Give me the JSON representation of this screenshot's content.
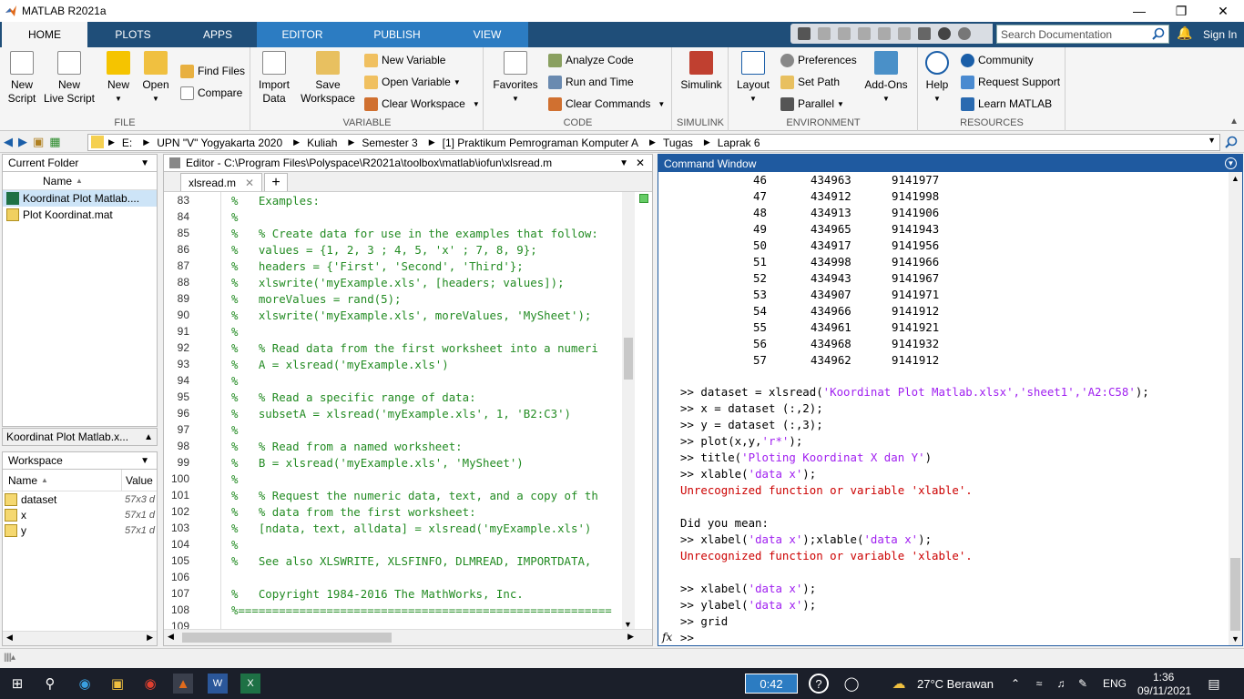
{
  "window": {
    "title": "MATLAB R2021a"
  },
  "tabs": [
    {
      "label": "HOME"
    },
    {
      "label": "PLOTS"
    },
    {
      "label": "APPS"
    },
    {
      "label": "EDITOR"
    },
    {
      "label": "PUBLISH"
    },
    {
      "label": "VIEW"
    }
  ],
  "search_doc": {
    "placeholder": "Search Documentation"
  },
  "sign_in": "Sign In",
  "ribbon": {
    "file": {
      "label": "FILE",
      "new_script": "New\nScript",
      "new_live_script": "New\nLive Script",
      "new": "New",
      "open": "Open",
      "find_files": "Find Files",
      "compare": "Compare"
    },
    "variable": {
      "label": "VARIABLE",
      "import_data": "Import\nData",
      "save_workspace": "Save\nWorkspace",
      "new_variable": "New Variable",
      "open_variable": "Open Variable",
      "clear_workspace": "Clear Workspace"
    },
    "code": {
      "label": "CODE",
      "favorites": "Favorites",
      "analyze_code": "Analyze Code",
      "run_and_time": "Run and Time",
      "clear_commands": "Clear Commands"
    },
    "simulink": {
      "label": "SIMULINK",
      "simulink": "Simulink"
    },
    "environment": {
      "label": "ENVIRONMENT",
      "layout": "Layout",
      "preferences": "Preferences",
      "set_path": "Set Path",
      "parallel": "Parallel",
      "add_ons": "Add-Ons"
    },
    "resources": {
      "label": "RESOURCES",
      "help": "Help",
      "community": "Community",
      "request_support": "Request Support",
      "learn_matlab": "Learn MATLAB"
    }
  },
  "address": {
    "crumbs": [
      "E:",
      "UPN \"V\" Yogyakarta 2020",
      "Kuliah",
      "Semester 3",
      "[1] Praktikum Pemrograman Komputer A",
      "Tugas",
      "Laprak 6"
    ]
  },
  "current_folder": {
    "title": "Current Folder",
    "column": "Name",
    "files": [
      {
        "name": "Koordinat Plot Matlab...."
      },
      {
        "name": "Plot Koordinat.mat"
      }
    ],
    "detail": "Koordinat Plot Matlab.x..."
  },
  "workspace": {
    "title": "Workspace",
    "col_name": "Name",
    "col_value": "Value",
    "vars": [
      {
        "name": "dataset",
        "value": "57x3 d"
      },
      {
        "name": "x",
        "value": "57x1 d"
      },
      {
        "name": "y",
        "value": "57x1 d"
      }
    ]
  },
  "editor": {
    "title": "Editor - C:\\Program Files\\Polyspace\\R2021a\\toolbox\\matlab\\iofun\\xlsread.m",
    "tab": "xlsread.m",
    "lines": [
      {
        "n": "83",
        "t": "%   Examples:"
      },
      {
        "n": "84",
        "t": "%"
      },
      {
        "n": "85",
        "t": "%   % Create data for use in the examples that follow:"
      },
      {
        "n": "86",
        "t": "%   values = {1, 2, 3 ; 4, 5, 'x' ; 7, 8, 9};"
      },
      {
        "n": "87",
        "t": "%   headers = {'First', 'Second', 'Third'};"
      },
      {
        "n": "88",
        "t": "%   xlswrite('myExample.xls', [headers; values]);"
      },
      {
        "n": "89",
        "t": "%   moreValues = rand(5);"
      },
      {
        "n": "90",
        "t": "%   xlswrite('myExample.xls', moreValues, 'MySheet');"
      },
      {
        "n": "91",
        "t": "%"
      },
      {
        "n": "92",
        "t": "%   % Read data from the first worksheet into a numeri"
      },
      {
        "n": "93",
        "t": "%   A = xlsread('myExample.xls')"
      },
      {
        "n": "94",
        "t": "%"
      },
      {
        "n": "95",
        "t": "%   % Read a specific range of data:"
      },
      {
        "n": "96",
        "t": "%   subsetA = xlsread('myExample.xls', 1, 'B2:C3')"
      },
      {
        "n": "97",
        "t": "%"
      },
      {
        "n": "98",
        "t": "%   % Read from a named worksheet:"
      },
      {
        "n": "99",
        "t": "%   B = xlsread('myExample.xls', 'MySheet')"
      },
      {
        "n": "100",
        "t": "%"
      },
      {
        "n": "101",
        "t": "%   % Request the numeric data, text, and a copy of th"
      },
      {
        "n": "102",
        "t": "%   % data from the first worksheet:"
      },
      {
        "n": "103",
        "t": "%   [ndata, text, alldata] = xlsread('myExample.xls')"
      },
      {
        "n": "104",
        "t": "%"
      },
      {
        "n": "105",
        "t": "%   See also XLSWRITE, XLSFINFO, DLMREAD, IMPORTDATA,"
      },
      {
        "n": "106",
        "t": ""
      },
      {
        "n": "107",
        "t": "%   Copyright 1984-2016 The MathWorks, Inc."
      },
      {
        "n": "108",
        "t": "%======================================================="
      },
      {
        "n": "109",
        "t": ""
      }
    ]
  },
  "command_window": {
    "title": "Command Window",
    "table_rows": [
      {
        "i": "46",
        "x": "434963",
        "y": "9141977"
      },
      {
        "i": "47",
        "x": "434912",
        "y": "9141998"
      },
      {
        "i": "48",
        "x": "434913",
        "y": "9141906"
      },
      {
        "i": "49",
        "x": "434965",
        "y": "9141943"
      },
      {
        "i": "50",
        "x": "434917",
        "y": "9141956"
      },
      {
        "i": "51",
        "x": "434998",
        "y": "9141966"
      },
      {
        "i": "52",
        "x": "434943",
        "y": "9141967"
      },
      {
        "i": "53",
        "x": "434907",
        "y": "9141971"
      },
      {
        "i": "54",
        "x": "434966",
        "y": "9141912"
      },
      {
        "i": "55",
        "x": "434961",
        "y": "9141921"
      },
      {
        "i": "56",
        "x": "434968",
        "y": "9141932"
      },
      {
        "i": "57",
        "x": "434962",
        "y": "9141912"
      }
    ],
    "cmd1": ">> dataset = xlsread(",
    "cmd1_str": "'Koordinat Plot Matlab.xlsx','sheet1','A2:C58'",
    "cmd1_end": ");",
    "cmd2": ">> x = dataset (:,2);",
    "cmd3": ">> y = dataset (:,3);",
    "cmd4": ">> plot(x,y,",
    "cmd4_str": "'r*'",
    "cmd4_end": ");",
    "cmd5": ">> title(",
    "cmd5_str": "'Ploting Koordinat X dan Y'",
    "cmd5_end": ")",
    "cmd6": ">> xlable(",
    "cmd6_str": "'data x'",
    "cmd6_end": ");",
    "err1": "Unrecognized function or variable 'xlable'.",
    "didyoumean": "Did you mean:",
    "cmd7": ">> xlabel(",
    "cmd7_str": "'data x'",
    "cmd7_mid": ");xlable(",
    "cmd7_str2": "'data x'",
    "cmd7_end": ");",
    "err2": "Unrecognized function or variable 'xlable'.",
    "cmd8": ">> xlabel(",
    "cmd8_str": "'data x'",
    "cmd8_end": ");",
    "cmd9": ">> ylabel(",
    "cmd9_str": "'data x'",
    "cmd9_end": ");",
    "cmd10": ">> grid",
    "prompt": ">>",
    "fx": "fx"
  },
  "taskbar": {
    "timer": "0:42",
    "weather": "27°C  Berawan",
    "lang": "ENG",
    "time": "1:36",
    "date": "09/11/2021"
  },
  "colors": {
    "tab_bar": "#1f4e79",
    "editor_tab_group": "#2c7cc2",
    "command_header": "#1f5aa0",
    "comment_green": "#228b22",
    "error_red": "#cc0000",
    "string_purple": "#a020f0"
  }
}
